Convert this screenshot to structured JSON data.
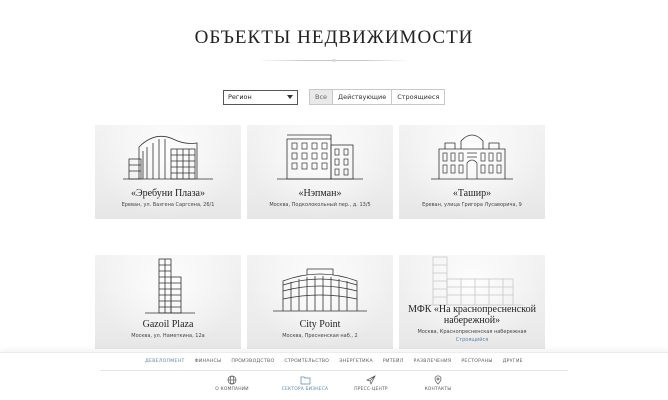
{
  "page": {
    "title": "ОБЪЕКТЫ НЕДВИЖИМОСТИ"
  },
  "filters": {
    "region_label": "Регион",
    "tabs": [
      {
        "label": "Все",
        "active": true
      },
      {
        "label": "Действующие",
        "active": false
      },
      {
        "label": "Строящиеся",
        "active": false
      }
    ]
  },
  "cards": [
    {
      "name": "«Эребуни Плаза»",
      "address": "Ереван, ул. Вазгена Саргсяна, 26/1",
      "icon": "erebuni-building-icon"
    },
    {
      "name": "«Нэпман»",
      "address": "Москва, Подколокольный пер., д. 13/5",
      "icon": "nepman-building-icon"
    },
    {
      "name": "«Ташир»",
      "address": "Ереван, улица Григора Лусаворича, 9",
      "icon": "tashir-building-icon"
    },
    {
      "name": "Gazoil Plaza",
      "address": "Москва, ул. Наметкина, 12а",
      "icon": "gazoil-tower-icon"
    },
    {
      "name": "City Point",
      "address": "Москва, Пресненская наб., 2",
      "icon": "city-point-building-icon"
    },
    {
      "name": "МФК «На краснопресненской набережной»",
      "address": "Москва, Краснопресненская набережная",
      "status": "Строящийся",
      "icon": "mfk-building-icon"
    }
  ],
  "sectors": [
    {
      "label": "ДЕВЕЛОПМЕНТ",
      "active": true
    },
    {
      "label": "ФИНАНСЫ",
      "active": false
    },
    {
      "label": "ПРОИЗВОДСТВО",
      "active": false
    },
    {
      "label": "СТРОИТЕЛЬСТВО",
      "active": false
    },
    {
      "label": "ЭНЕРГЕТИКА",
      "active": false
    },
    {
      "label": "РИТЕЙЛ",
      "active": false
    },
    {
      "label": "РАЗВЛЕЧЕНИЯ",
      "active": false
    },
    {
      "label": "РЕСТОРАНЫ",
      "active": false
    },
    {
      "label": "ДРУГИЕ",
      "active": false
    }
  ],
  "main_nav": [
    {
      "label": "О КОМПАНИИ",
      "icon": "globe-icon",
      "active": false
    },
    {
      "label": "СЕКТОРА БИЗНЕСА",
      "icon": "folder-icon",
      "active": true
    },
    {
      "label": "ПРЕСС-ЦЕНТР",
      "icon": "paper-plane-icon",
      "active": false
    },
    {
      "label": "КОНТАКТЫ",
      "icon": "location-pin-icon",
      "active": false
    }
  ],
  "colors": {
    "accent": "#5a86a8",
    "card_bg": "#ececec",
    "text": "#222222"
  }
}
